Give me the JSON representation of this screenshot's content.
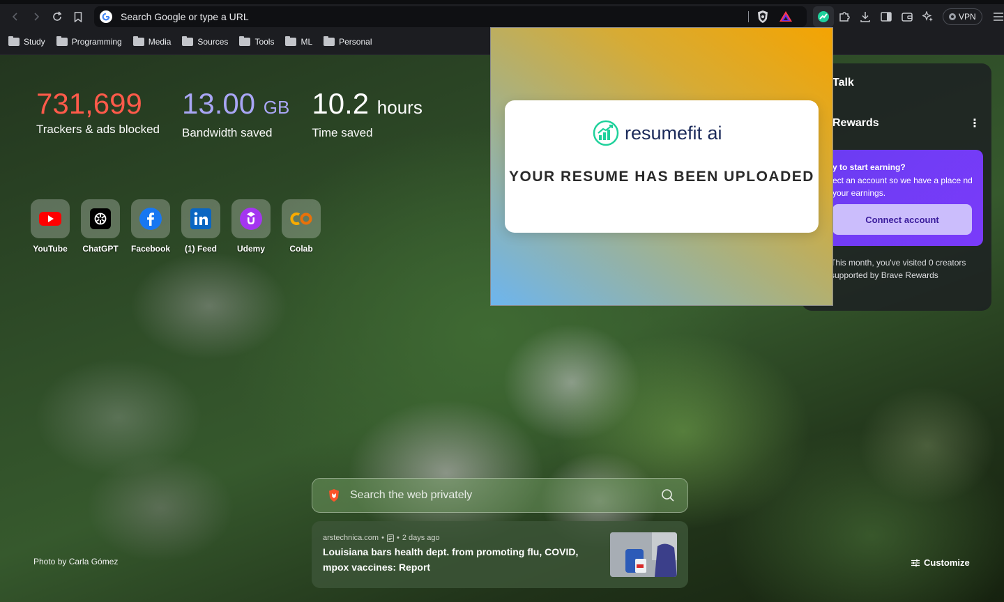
{
  "browser": {
    "omnibox_placeholder": "Search Google or type a URL",
    "vpn_label": "VPN",
    "toolbar_icons": [
      "back-icon",
      "forward-icon",
      "reload-icon",
      "bookmark-icon",
      "google-icon",
      "brave-shields-icon",
      "brave-rewards-icon",
      "resumefit-extension-icon",
      "puzzle-icon",
      "download-icon",
      "sidebar-icon",
      "wallet-icon",
      "leo-ai-icon",
      "menu-icon"
    ]
  },
  "bookmarks": [
    {
      "label": "Study"
    },
    {
      "label": "Programming"
    },
    {
      "label": "Media"
    },
    {
      "label": "Sources"
    },
    {
      "label": "Tools"
    },
    {
      "label": "ML"
    },
    {
      "label": "Personal"
    }
  ],
  "stats": {
    "trackers": {
      "value": "731,699",
      "label": "Trackers & ads blocked",
      "color": "#ff5a4a"
    },
    "bandwidth": {
      "value": "13.00",
      "unit": "GB",
      "label": "Bandwidth saved",
      "color": "#a9a6f5"
    },
    "time": {
      "value": "10.2",
      "unit": "hours",
      "label": "Time saved"
    }
  },
  "top_sites": [
    {
      "label": "YouTube",
      "icon": "youtube-icon"
    },
    {
      "label": "ChatGPT",
      "icon": "chatgpt-icon"
    },
    {
      "label": "Facebook",
      "icon": "facebook-icon"
    },
    {
      "label": "(1) Feed",
      "icon": "linkedin-icon"
    },
    {
      "label": "Udemy",
      "icon": "udemy-icon"
    },
    {
      "label": "Colab",
      "icon": "colab-icon"
    }
  ],
  "rewards_card": {
    "talk_title": "Talk",
    "rewards_title": "Rewards",
    "earn_heading": "y to start earning?",
    "earn_text": "ect an account so we have a place nd your earnings.",
    "connect_label": "Connect account",
    "visited_text": "This month, you've visited 0 creators supported by Brave Rewards"
  },
  "popup": {
    "brand": "resumefit ai",
    "message": "YOUR RESUME HAS BEEN UPLOADED",
    "accent": "#1fd19b"
  },
  "search": {
    "placeholder": "Search the web privately"
  },
  "news": {
    "source": "arstechnica.com",
    "age": "2 days ago",
    "title": "Louisiana bars health dept. from promoting flu, COVID, mpox vaccines: Report"
  },
  "footer": {
    "credit": "Photo by Carla Gómez",
    "customize": "Customize"
  }
}
